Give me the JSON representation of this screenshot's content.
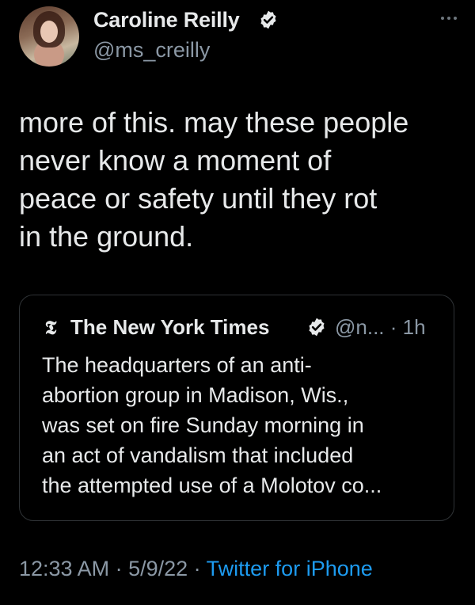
{
  "author": {
    "display_name": "Caroline Reilly",
    "handle": "@ms_creilly",
    "verified": true
  },
  "menu": {
    "icon": "more-horizontal-icon"
  },
  "tweet": {
    "text": "more of this. may these people\nnever know a moment of\npeace or safety until they rot\nin the ground."
  },
  "quoted_tweet": {
    "logo": "𝕿",
    "display_name": "The New York Times",
    "handle_time": "@n... · 1h",
    "text": "The headquarters of an anti-\nabortion group in Madison, Wis.,\nwas set on fire Sunday morning in\nan act of vandalism that included\nthe attempted use of a Molotov co..."
  },
  "footer": {
    "time": "12:33 AM",
    "separator1": " · ",
    "date": "5/9/22",
    "separator2": " · ",
    "source": "Twitter for iPhone"
  },
  "colors": {
    "background": "#000000",
    "text": "#e7e9ea",
    "secondary": "#8b98a5",
    "link": "#1d9bf0",
    "verified": "#e7e9ea",
    "border": "#2f3336"
  }
}
